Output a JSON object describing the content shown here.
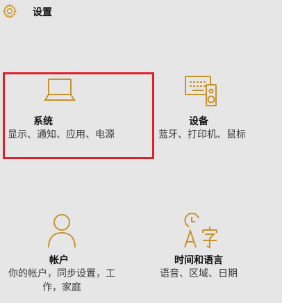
{
  "header": {
    "title": "设置",
    "icon": "gear-icon"
  },
  "accent_color": "#c8922a",
  "highlight_color": "#e0202a",
  "tiles": [
    {
      "id": "system",
      "icon": "laptop-icon",
      "name": "系统",
      "desc": "显示、通知、应用、电源"
    },
    {
      "id": "devices",
      "icon": "devices-icon",
      "name": "设备",
      "desc": "蓝牙、打印机、鼠标"
    },
    {
      "id": "accounts",
      "icon": "person-icon",
      "name": "帐户",
      "desc": "你的帐户，同步设置，工作，家庭"
    },
    {
      "id": "time",
      "icon": "time-language-icon",
      "name": "时间和语言",
      "desc": "语音、区域、日期"
    }
  ]
}
